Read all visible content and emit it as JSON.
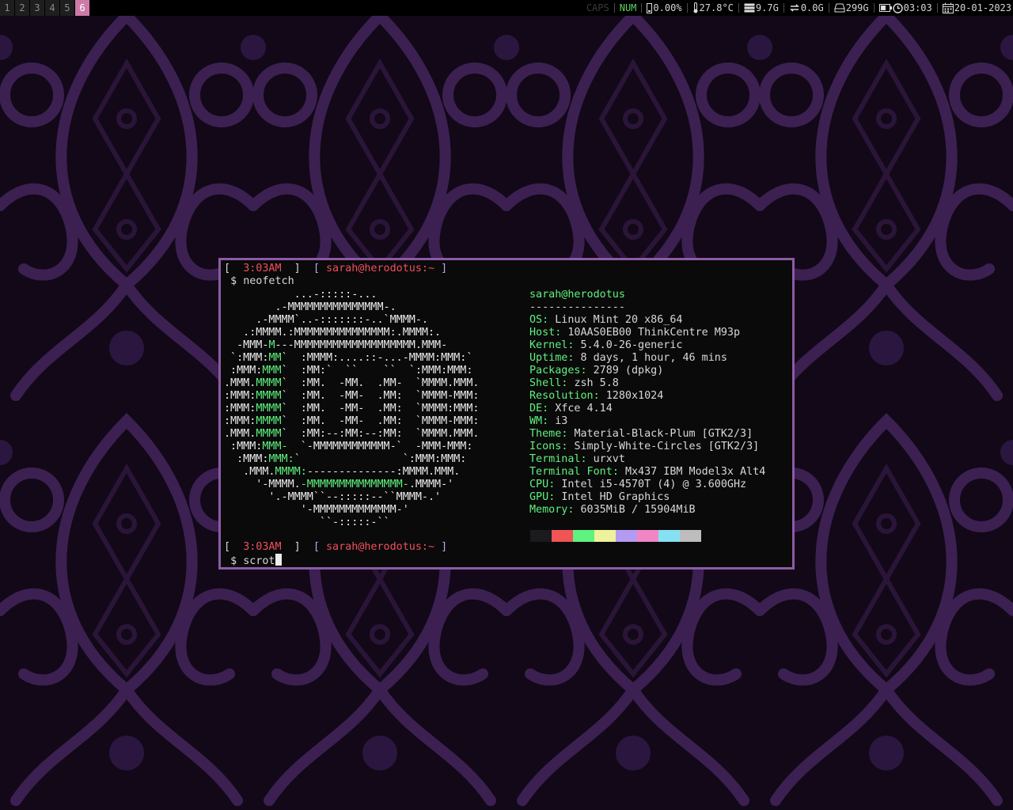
{
  "bar": {
    "workspaces": [
      "1",
      "2",
      "3",
      "4",
      "5",
      "6"
    ],
    "active_workspace": "6",
    "caps": "CAPS",
    "num": "NUM",
    "cpu": "0.00%",
    "temp": "27.8°C",
    "ram": "9.7G",
    "swap": "0.0G",
    "disk": "299G",
    "time": "03:03",
    "date": "20-01-2023",
    "icons": [
      "cpu-icon",
      "thermometer-icon",
      "memory-icon",
      "swap-icon",
      "disk-icon",
      "battery-icon",
      "clock-icon",
      "calendar-icon"
    ]
  },
  "terminal": {
    "prompt_time": "3:03AM",
    "prompt_user": "sarah@herodotus:~",
    "prompt_symbol": "$",
    "command1": "neofetch",
    "command2": "scrot",
    "art": [
      [
        [
          "w",
          "           ...-:::::-..."
        ]
      ],
      [
        [
          "w",
          "        .-MMMMMMMMMMMMMMM-."
        ]
      ],
      [
        [
          "w",
          "     .-MMMM`..-:::::::-..`MMMM-."
        ]
      ],
      [
        [
          "w",
          "   .:MMMM.:MMMMMMMMMMMMMMM:.MMMM:."
        ]
      ],
      [
        [
          "w",
          "  -MMM-"
        ],
        [
          "g",
          "M"
        ],
        [
          "w",
          "---MMMMMMMMMMMMMMMMMMM.MMM-"
        ]
      ],
      [
        [
          "w",
          " `:MMM:"
        ],
        [
          "g",
          "MM"
        ],
        [
          "w",
          "`  :MMMM:....::-...-MMMM:MMM:`"
        ]
      ],
      [
        [
          "w",
          " :MMM:"
        ],
        [
          "g",
          "MMM"
        ],
        [
          "w",
          "`  :MM:`  ``    ``  `:MMM:MMM:"
        ]
      ],
      [
        [
          "w",
          ".MMM."
        ],
        [
          "g",
          "MMMM"
        ],
        [
          "w",
          "`  :MM.  -MM.  .MM-  `MMMM.MMM."
        ]
      ],
      [
        [
          "w",
          ":MMM:"
        ],
        [
          "g",
          "MMMM"
        ],
        [
          "w",
          "`  :MM.  -MM-  .MM:  `MMMM-MMM:"
        ]
      ],
      [
        [
          "w",
          ":MMM:"
        ],
        [
          "g",
          "MMMM"
        ],
        [
          "w",
          "`  :MM.  -MM-  .MM:  `MMMM:MMM:"
        ]
      ],
      [
        [
          "w",
          ":MMM:"
        ],
        [
          "g",
          "MMMM"
        ],
        [
          "w",
          "`  :MM.  -MM-  .MM:  `MMMM-MMM:"
        ]
      ],
      [
        [
          "w",
          ".MMM."
        ],
        [
          "g",
          "MMMM"
        ],
        [
          "w",
          "`  :MM:--:MM:--:MM:  `MMMM.MMM."
        ]
      ],
      [
        [
          "w",
          " :MMM:"
        ],
        [
          "g",
          "MMM-"
        ],
        [
          "w",
          "  `-MMMMMMMMMMMM-`  -MMM-MMM:"
        ]
      ],
      [
        [
          "w",
          "  :MMM:"
        ],
        [
          "g",
          "MMM:"
        ],
        [
          "w",
          "`                `:MMM:MMM:"
        ]
      ],
      [
        [
          "w",
          "   .MMM."
        ],
        [
          "g",
          "MMMM:"
        ],
        [
          "w",
          "--------------:MMMM.MMM."
        ]
      ],
      [
        [
          "w",
          "     '-MMMM."
        ],
        [
          "g",
          "-MMMMMMMMMMMMMMM-"
        ],
        [
          "w",
          ".MMMM-'"
        ]
      ],
      [
        [
          "w",
          "       '.-MMMM``--:::::--``MMMM-.'"
        ]
      ],
      [
        [
          "w",
          "            '-MMMMMMMMMMMMM-'"
        ]
      ],
      [
        [
          "w",
          "               ``-:::::-``"
        ]
      ]
    ],
    "info_title": "sarah@herodotus",
    "info_rule": "---------------",
    "info": [
      {
        "key": "OS",
        "value": "Linux Mint 20 x86_64"
      },
      {
        "key": "Host",
        "value": "10AAS0EB00 ThinkCentre M93p"
      },
      {
        "key": "Kernel",
        "value": "5.4.0-26-generic"
      },
      {
        "key": "Uptime",
        "value": "8 days, 1 hour, 46 mins"
      },
      {
        "key": "Packages",
        "value": "2789 (dpkg)"
      },
      {
        "key": "Shell",
        "value": "zsh 5.8"
      },
      {
        "key": "Resolution",
        "value": "1280x1024"
      },
      {
        "key": "DE",
        "value": "Xfce 4.14"
      },
      {
        "key": "WM",
        "value": "i3"
      },
      {
        "key": "Theme",
        "value": "Material-Black-Plum [GTK2/3]"
      },
      {
        "key": "Icons",
        "value": "Simply-White-Circles [GTK2/3]"
      },
      {
        "key": "Terminal",
        "value": "urxvt"
      },
      {
        "key": "Terminal Font",
        "value": "Mx437 IBM Model3x Alt4"
      },
      {
        "key": "CPU",
        "value": "Intel i5-4570T (4) @ 3.600GHz"
      },
      {
        "key": "GPU",
        "value": "Intel HD Graphics"
      },
      {
        "key": "Memory",
        "value": "6035MiB / 15904MiB"
      }
    ],
    "palette": [
      "#1a1a1f",
      "#f05454",
      "#5ff27f",
      "#eef29a",
      "#b59af2",
      "#f286c4",
      "#86e0f2",
      "#bdbdbd"
    ]
  }
}
